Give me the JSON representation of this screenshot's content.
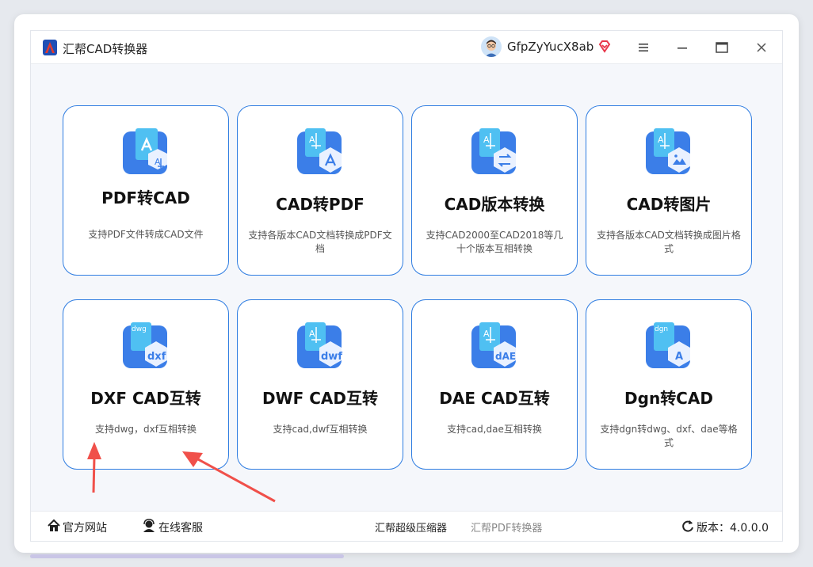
{
  "titlebar": {
    "app_title": "汇帮CAD转换器",
    "username": "GfpZyYucX8ab"
  },
  "cards": [
    {
      "title": "PDF转CAD",
      "desc": "支持PDF文件转成CAD文件",
      "icon": "pdf-to-cad-icon"
    },
    {
      "title": "CAD转PDF",
      "desc": "支持各版本CAD文档转换成PDF文档",
      "icon": "cad-to-pdf-icon"
    },
    {
      "title": "CAD版本转换",
      "desc": "支持CAD2000至CAD2018等几十个版本互相转换",
      "icon": "cad-version-icon"
    },
    {
      "title": "CAD转图片",
      "desc": "支持各版本CAD文档转换成图片格式",
      "icon": "cad-to-image-icon"
    },
    {
      "title": "DXF CAD互转",
      "desc": "支持dwg，dxf互相转换",
      "icon": "dxf-icon"
    },
    {
      "title": "DWF CAD互转",
      "desc": "支持cad,dwf互相转换",
      "icon": "dwf-icon"
    },
    {
      "title": "DAE CAD互转",
      "desc": "支持cad,dae互相转换",
      "icon": "dae-icon"
    },
    {
      "title": "Dgn转CAD",
      "desc": "支持dgn转dwg、dxf、dae等格式",
      "icon": "dgn-icon"
    }
  ],
  "footer": {
    "website": "官方网站",
    "support": "在线客服",
    "link1": "汇帮超级压缩器",
    "link2": "汇帮PDF转换器",
    "version_label": "版本：4.0.0.0"
  },
  "colors": {
    "accent": "#2f7de1",
    "icon_blue": "#3b7ee8",
    "arrow_red": "#f0504a"
  }
}
